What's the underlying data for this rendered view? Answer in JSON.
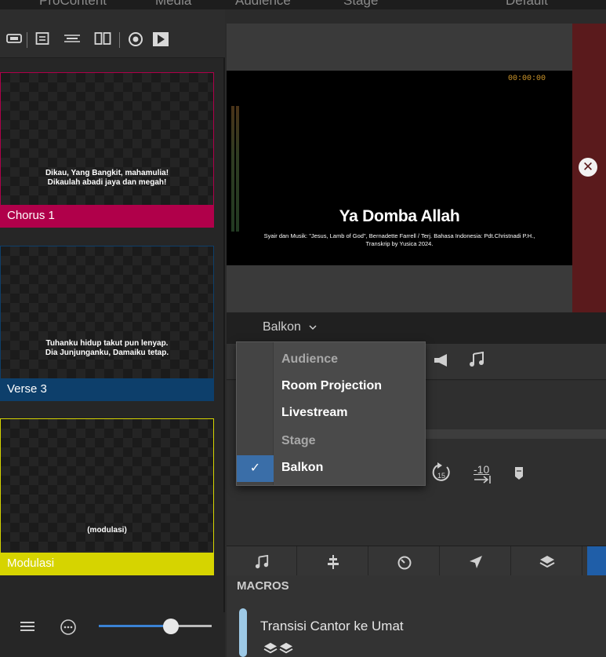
{
  "menu": {
    "items": [
      "ProContent",
      "Media",
      "Audience",
      "Stage",
      "Default"
    ]
  },
  "slides": [
    {
      "line1": "Dikau, Yang Bangkit, mahamulia!",
      "line2": "Dikaulah abadi jaya dan megah!",
      "label": "Chorus 1",
      "color": "#b0004a"
    },
    {
      "line1": "Tuhanku hidup takut pun lenyap.",
      "line2": "Dia Junjunganku, Damaiku tetap.",
      "label": "Verse 3",
      "color": "#0d3f6b"
    },
    {
      "line1": "(modulasi)",
      "line2": "",
      "label": "Modulasi",
      "color": "#d6d400"
    }
  ],
  "preview": {
    "timer": "00:00:00",
    "title": "Ya Domba Allah",
    "credit_line1": "Syair dan Musik: \"Jesus, Lamb of God\", Bernadette Farrell / Terj. Bahasa Indonesia: Pdt.Christnadi P.H.,",
    "credit_line2": "Transkrip by Yusica 2024."
  },
  "screen_selector": {
    "value": "Balkon",
    "chevron": "chevron-down-icon"
  },
  "dropdown": {
    "items": [
      {
        "label": "Audience",
        "kind": "header"
      },
      {
        "label": "Room Projection",
        "kind": "option"
      },
      {
        "label": "Livestream",
        "kind": "option"
      },
      {
        "label": "Stage",
        "kind": "header"
      },
      {
        "label": "Balkon",
        "kind": "option",
        "checked": true
      }
    ]
  },
  "controls": {
    "skip_back": "-10"
  },
  "macros": {
    "header": "MACROS",
    "items": [
      {
        "name": "Transisi Cantor ke Umat"
      }
    ]
  },
  "colors": {
    "accent": "#1f5ea8",
    "check": "#3a6ea8",
    "timer": "#d39a2c",
    "preview_side": "#5a1a1c"
  }
}
